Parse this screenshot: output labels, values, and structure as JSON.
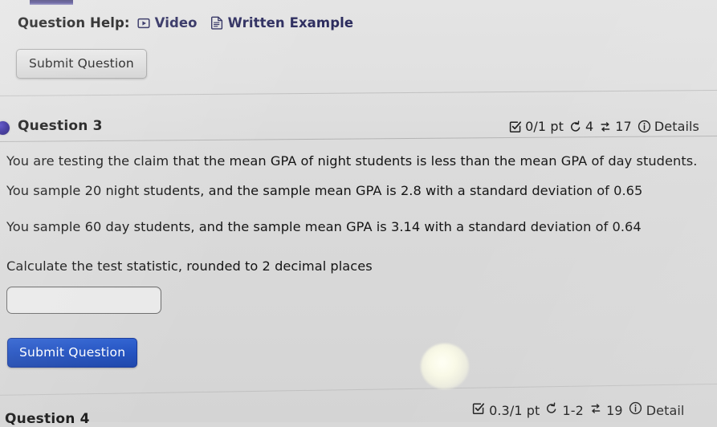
{
  "help": {
    "label": "Question Help:",
    "links": [
      {
        "icon": "video-icon",
        "text": "Video"
      },
      {
        "icon": "document-icon",
        "text": "Written Example"
      }
    ]
  },
  "top_submit": {
    "label": "Submit Question"
  },
  "question3": {
    "title": "Question 3",
    "bullet_color": "#2a1f8f",
    "meta": {
      "points": "0/1 pt",
      "attempts": "4",
      "versions": "17",
      "details": "Details",
      "icons": {
        "points": "checkbox-checked-icon",
        "attempts": "retry-icon",
        "versions": "shuffle-icon",
        "details": "info-icon"
      }
    },
    "body": [
      "You are testing the claim that the mean GPA of night students is less than the mean GPA of day students.",
      "You sample 20 night students, and the sample mean GPA is 2.8 with a standard deviation of 0.65",
      "You sample 60 day students, and the sample mean GPA is 3.14 with a standard deviation of 0.64",
      "Calculate the test statistic, rounded to 2 decimal places"
    ],
    "answer": {
      "value": "",
      "placeholder": ""
    },
    "submit": {
      "label": "Submit Question",
      "color": "#1f4fbf"
    }
  },
  "question4": {
    "title": "Question 4",
    "meta": {
      "points": "0.3/1 pt",
      "attempts": "1-2",
      "versions": "19",
      "details": "Detail",
      "icons": {
        "points": "checkbox-checked-icon",
        "attempts": "retry-icon",
        "versions": "shuffle-icon",
        "details": "info-icon"
      }
    }
  }
}
